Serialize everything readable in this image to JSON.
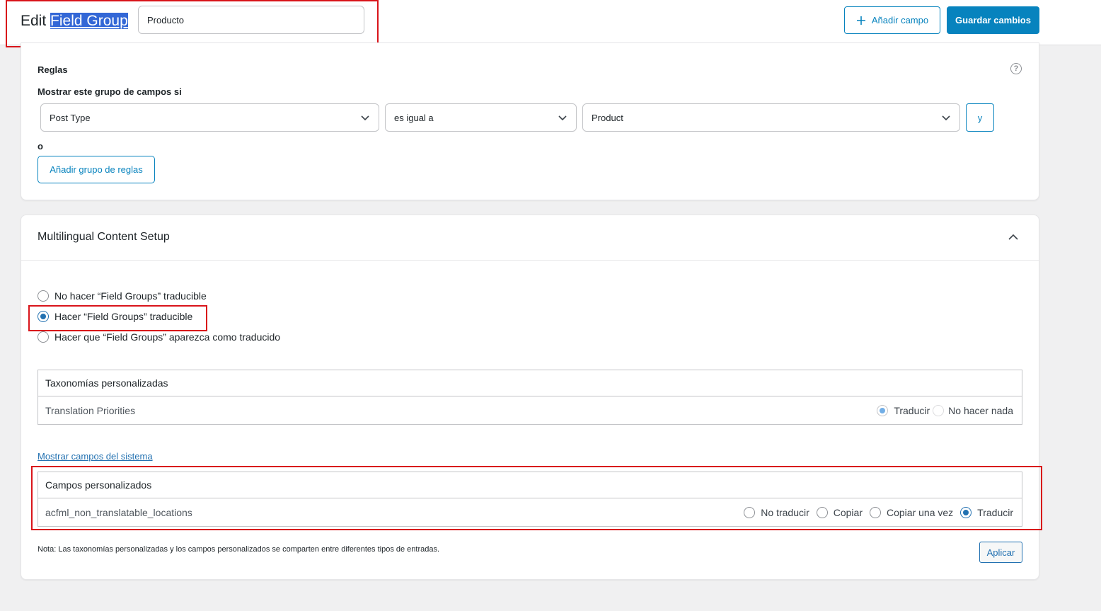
{
  "header": {
    "title_prefix": "Edit",
    "title_highlight": "Field Group",
    "title_input_value": "Producto",
    "add_field_label": "Añadir campo",
    "save_label": "Guardar cambios"
  },
  "rules": {
    "heading": "Reglas",
    "subheading": "Mostrar este grupo de campos si",
    "param": "Post Type",
    "operator": "es igual a",
    "value": "Product",
    "and_label": "y",
    "or_label": "o",
    "add_group_label": "Añadir grupo de reglas",
    "help_icon": "?"
  },
  "multilingual": {
    "heading": "Multilingual Content Setup",
    "options": [
      {
        "label": "No hacer “Field Groups” traducible",
        "checked": false
      },
      {
        "label": "Hacer “Field Groups” traducible",
        "checked": true
      },
      {
        "label": "Hacer que “Field Groups” aparezca como traducido",
        "checked": false
      }
    ],
    "taxonomies": {
      "header": "Taxonomías personalizadas",
      "row_label": "Translation Priorities",
      "options": [
        "Traducir",
        "No hacer nada"
      ],
      "selected": "Traducir"
    },
    "show_system_fields": "Mostrar campos del sistema",
    "custom_fields": {
      "header": "Campos personalizados",
      "row_label": "acfml_non_translatable_locations",
      "options": [
        "No traducir",
        "Copiar",
        "Copiar una vez",
        "Traducir"
      ],
      "selected": "Traducir"
    },
    "note": "Nota: Las taxonomías personalizadas y los campos personalizados se comparten entre diferentes tipos de entradas.",
    "apply_label": "Aplicar"
  }
}
